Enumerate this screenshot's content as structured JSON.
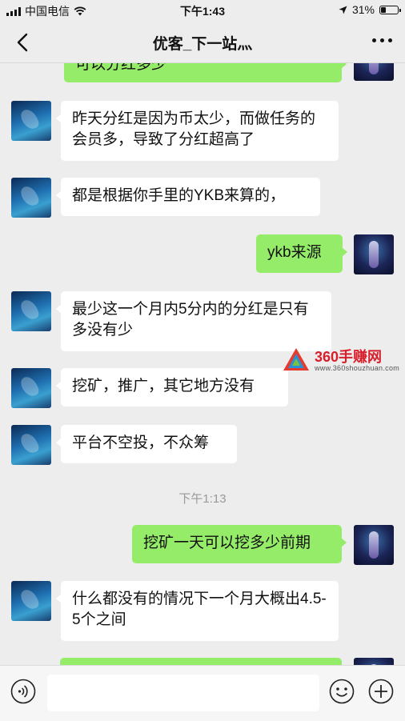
{
  "status_bar": {
    "carrier": "中国电信",
    "time": "下午1:43",
    "battery": "31%",
    "battery_level": 0.31
  },
  "header": {
    "title": "优客_下一站灬"
  },
  "messages": [
    {
      "side": "right",
      "text": "可以分红多少"
    },
    {
      "side": "left",
      "text": "昨天分红是因为币太少，而做任务的会员多，导致了分红超高了"
    },
    {
      "side": "left",
      "text": "都是根据你手里的YKB来算的，"
    },
    {
      "side": "right",
      "text": "ykb来源"
    },
    {
      "side": "left",
      "text": "最少这一个月内5分内的分红是只有多没有少"
    },
    {
      "side": "left",
      "text": "挖矿，推广，其它地方没有"
    },
    {
      "side": "left",
      "text": "平台不空投，不众筹"
    },
    {
      "side": "right",
      "text": "挖矿一天可以挖多少前期"
    },
    {
      "side": "left",
      "text": "什么都没有的情况下一个月大概出4.5-5个之间"
    }
  ],
  "timestamp": "下午1:13",
  "watermark": {
    "main": "360手赚网",
    "sub": "www.360shouzhuan.com"
  },
  "input": {
    "placeholder": ""
  },
  "colors": {
    "sent_bubble": "#95ec69",
    "received_bubble": "#ffffff",
    "background": "#ededed"
  }
}
